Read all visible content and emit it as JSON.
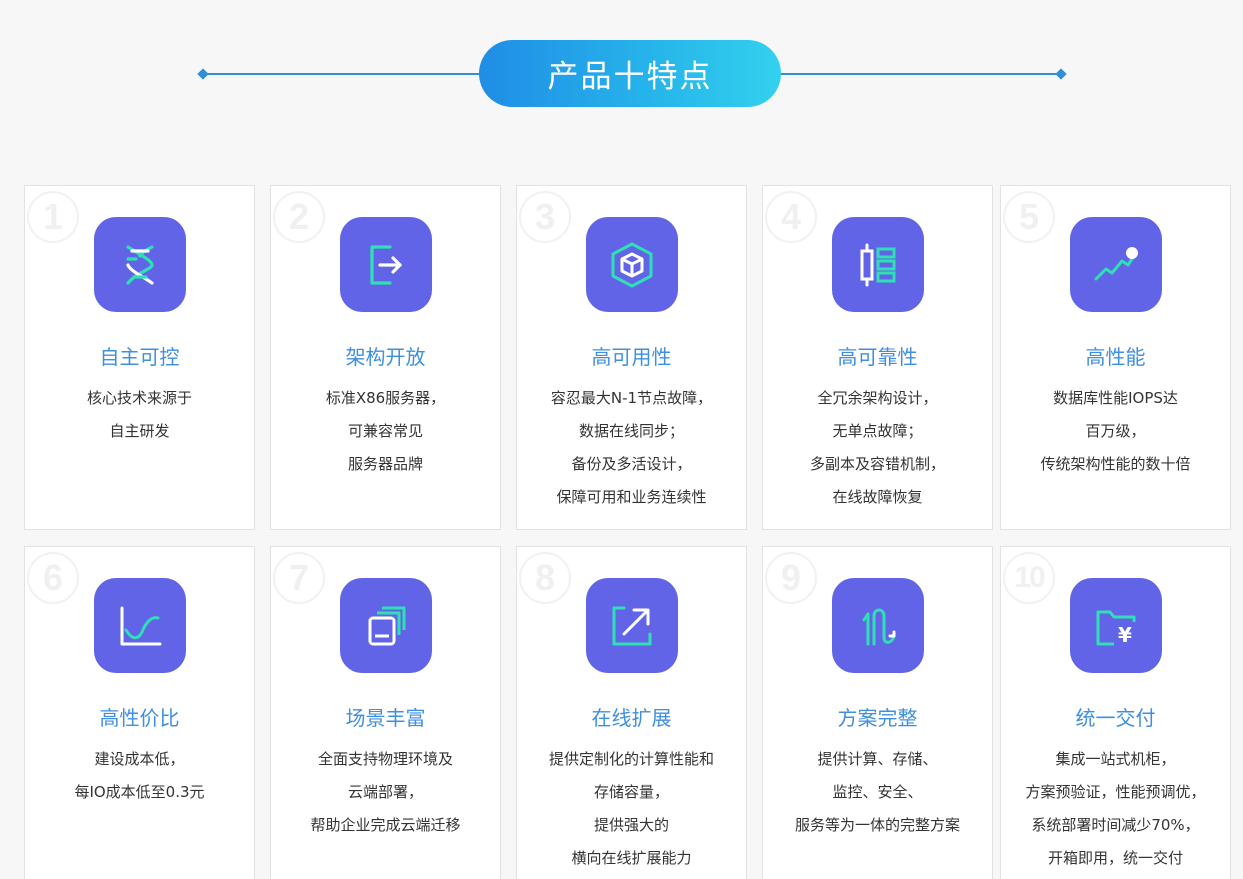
{
  "header": {
    "title": "产品十特点"
  },
  "features": [
    {
      "num": "1",
      "icon": "dna-icon",
      "title": "自主可控",
      "lines": [
        "核心技术来源于",
        "自主研发"
      ]
    },
    {
      "num": "2",
      "icon": "open-door-icon",
      "title": "架构开放",
      "lines": [
        "标准X86服务器，",
        "可兼容常见",
        "服务器品牌"
      ]
    },
    {
      "num": "3",
      "icon": "cube-icon",
      "title": "高可用性",
      "lines": [
        "容忍最大N-1节点故障，",
        "数据在线同步；",
        "备份及多活设计，",
        "保障可用和业务连续性"
      ]
    },
    {
      "num": "4",
      "icon": "redundancy-icon",
      "title": "高可靠性",
      "lines": [
        "全冗余架构设计，",
        "无单点故障；",
        "多副本及容错机制，",
        "在线故障恢复"
      ]
    },
    {
      "num": "5",
      "icon": "performance-trend-icon",
      "title": "高性能",
      "lines": [
        "数据库性能IOPS达",
        "百万级，",
        "传统架构性能的数十倍"
      ]
    },
    {
      "num": "6",
      "icon": "cost-curve-icon",
      "title": "高性价比",
      "lines": [
        "建设成本低，",
        "每IO成本低至0.3元"
      ]
    },
    {
      "num": "7",
      "icon": "stacked-windows-icon",
      "title": "场景丰富",
      "lines": [
        "全面支持物理环境及",
        "云端部署，",
        "帮助企业完成云端迁移"
      ]
    },
    {
      "num": "8",
      "icon": "expand-arrow-icon",
      "title": "在线扩展",
      "lines": [
        "提供定制化的计算性能和",
        "存储容量，",
        "提供强大的",
        "横向在线扩展能力"
      ]
    },
    {
      "num": "9",
      "icon": "integrated-path-icon",
      "title": "方案完整",
      "lines": [
        "提供计算、存储、",
        "监控、安全、",
        "服务等为一体的完整方案"
      ]
    },
    {
      "num": "10",
      "icon": "yen-folder-icon",
      "title": "统一交付",
      "lines": [
        "集成一站式机柜，",
        "方案预验证，性能预调优，",
        "系统部署时间减少70%，",
        "开箱即用，统一交付"
      ]
    }
  ],
  "colors": {
    "icon_bg": "#6164e6",
    "icon_stroke": "#2fe0b4",
    "title": "#3f8fe0",
    "header_gradient_start": "#1f8de6",
    "header_gradient_end": "#33d1ef"
  }
}
